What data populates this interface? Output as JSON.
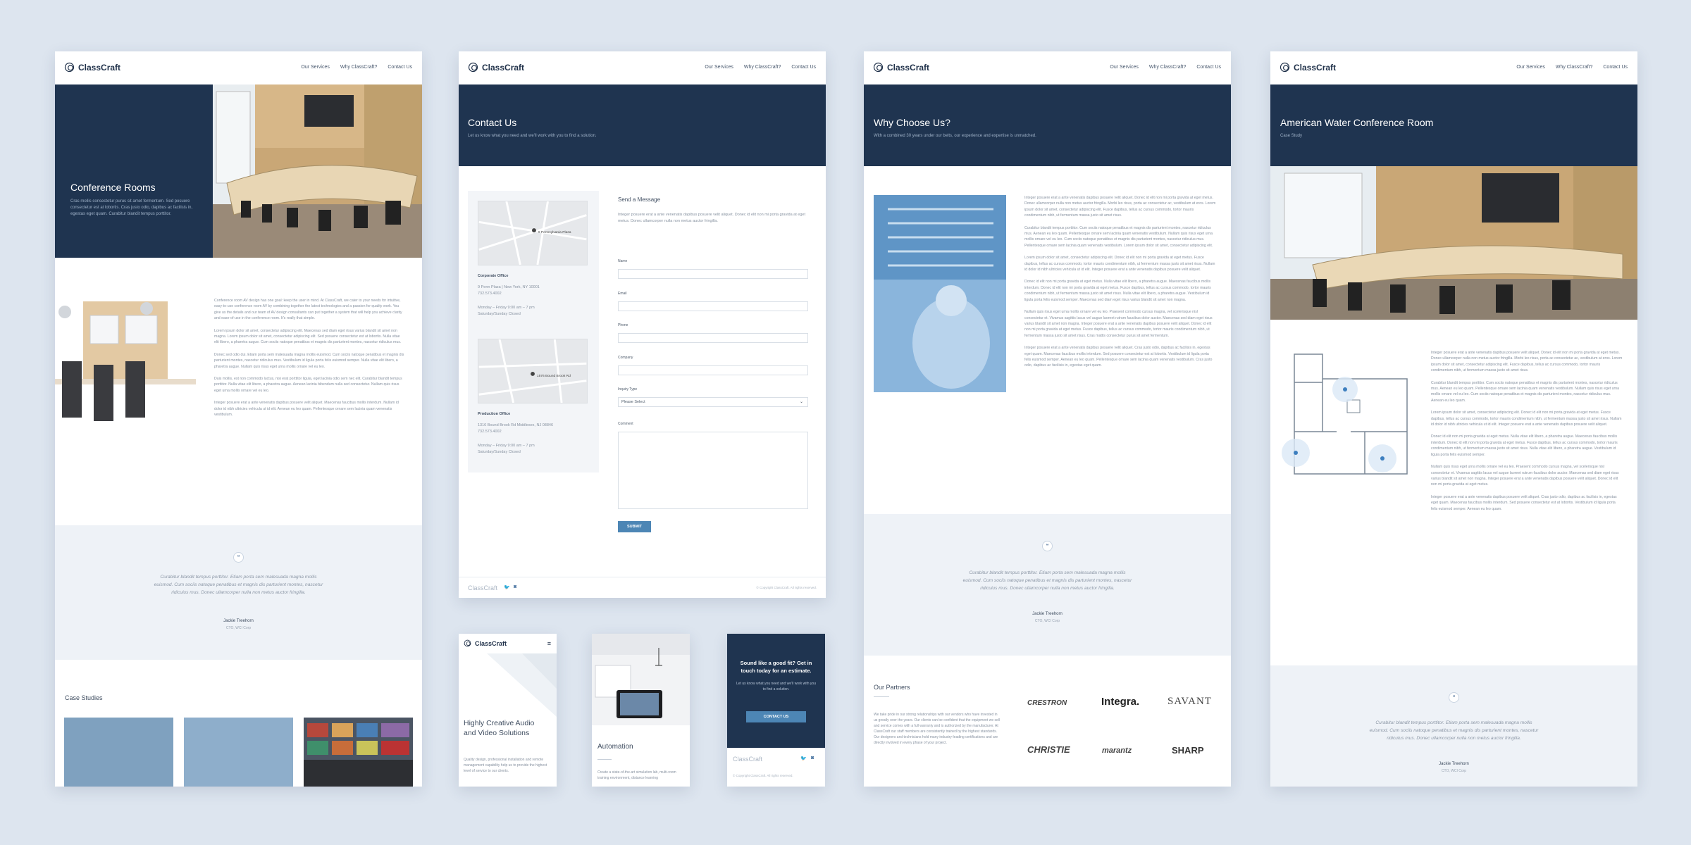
{
  "brand": {
    "name": "ClassCraft"
  },
  "nav": [
    "Our Services",
    "Why ClassCraft?",
    "Contact Us"
  ],
  "page1": {
    "hero_title": "Conference Rooms",
    "hero_sub": "Cras mollis consectetur purus sit amet fermentum. Sed posuere consectetur est at lobortis. Cras justo odio, dapibus ac facilisis in, egestas eget quam. Curabitur blandit tempus porttitor.",
    "paragraphs": [
      "Conference room AV design has one goal: keep the user in mind. At ClassCraft, we cater to your needs for intuitive, easy-to-use conference room AV by combining together the latest technologies and a passion for quality work. You give us the details and our team of AV design consultants can put together a system that will help you achieve clarity and ease-of-use in the conference room. It's really that simple.",
      "Lorem ipsum dolor sit amet, consectetur adipiscing elit. Maecenas sed diam eget risus varius blandit sit amet non magna. Lorem ipsum dolor sit amet, consectetur adipiscing elit. Sed posuere consectetur est at lobortis. Nulla vitae elit libero, a pharetra augue. Cum sociis natoque penatibus et magnis dis parturient montes, nascetur ridiculus mus.",
      "Donec sed odio dui. Etiam porta sem malesuada magna mollis euismod. Cum sociis natoque penatibus et magnis dis parturient montes, nascetur ridiculus mus. Vestibulum id ligula porta felis euismod semper. Nulla vitae elit libero, a pharetra augue. Nullam quis risus eget urna mollis ornare vel eu leo.",
      "Duis mollis, est non commodo luctus, nisi erat porttitor ligula, eget lacinia odio sem nec elit. Curabitur blandit tempus porttitor. Nulla vitae elit libero, a pharetra augue. Aenean lacinia bibendum nulla sed consectetur. Nullam quis risus eget urna mollis ornare vel eu leo.",
      "Integer posuere erat a ante venenatis dapibus posuere velit aliquet. Maecenas faucibus mollis interdum. Nullam id dolor id nibh ultricies vehicula ut id elit. Aenean eu leo quam. Pellentesque ornare sem lacinia quam venenatis vestibulum."
    ],
    "quote": "Curabitur blandit tempus porttitor. Etiam porta sem malesuada magna mollis euismod. Cum sociis natoque penatibus et magnis dis parturient montes, nascetur ridiculus mus. Donec ullamcorper nulla non metus auctor fringilla.",
    "quote_name": "Jackie Treehorn",
    "quote_role": "CTO, WCI Corp",
    "case_title": "Case Studies"
  },
  "page2": {
    "hero_title": "Contact Us",
    "hero_sub": "Let us know what you need and we'll work with you to find a solution.",
    "offices": [
      {
        "map_label": "9 Pennsylvania Plaza",
        "title": "Corporate Office",
        "address": "9 Penn Plaza | New York, NY 10001",
        "phone": "732.573.4002",
        "hours": "Monday – Friday 9:00 am – 7 pm",
        "weekend": "Saturday/Sunday Closed"
      },
      {
        "map_label": "1576 Bound Brook Rd",
        "title": "Production Office",
        "address": "1316 Bound Brook Rd Middlesex, NJ 08846",
        "phone": "732.573.4002",
        "hours": "Monday – Friday 9:00 am – 7 pm",
        "weekend": "Saturday/Sunday Closed"
      }
    ],
    "form_title": "Send a Message",
    "form_intro": "Integer posuere erat a ante venenatis dapibus posuere velit aliquet. Donec id elit non mi porta gravida at eget metus. Donec ullamcorper nulla non metus auctor fringilla.",
    "labels": {
      "name": "Name",
      "email": "Email",
      "phone": "Phone",
      "company": "Company",
      "inquiry": "Inquiry Type",
      "comment": "Comment"
    },
    "select_value": "Please Select",
    "submit": "SUBMIT",
    "copyright": "© Copyright ClassCraft. All rights reserved."
  },
  "page3": {
    "hero_title": "Why Choose Us?",
    "hero_sub": "With a combined 30 years under our belts, our experience and expertise is unmatched.",
    "paragraphs": [
      "Integer posuere erat a ante venenatis dapibus posuere velit aliquet. Donec id elit non mi porta gravida at eget metus. Donec ullamcorper nulla non metus auctor fringilla. Morbi leo risus, porta ac consectetur ac, vestibulum at eros. Lorem ipsum dolor sit amet, consectetur adipiscing elit. Fusce dapibus, tellus ac cursus commodo, tortor mauris condimentum nibh, ut fermentum massa justo sit amet risus.",
      "Curabitur blandit tempus porttitor. Cum sociis natoque penatibus et magnis dis parturient montes, nascetur ridiculus mus. Aenean eu leo quam. Pellentesque ornare sem lacinia quam venenatis vestibulum. Nullam quis risus eget urna mollis ornare vel eu leo. Cum sociis natoque penatibus et magnis dis parturient montes, nascetur ridiculus mus. Pellentesque ornare sem lacinia quam venenatis vestibulum. Lorem ipsum dolor sit amet, consectetur adipiscing elit.",
      "Lorem ipsum dolor sit amet, consectetur adipiscing elit. Donec id elit non mi porta gravida at eget metus. Fusce dapibus, tellus ac cursus commodo, tortor mauris condimentum nibh, ut fermentum massa justo sit amet risus. Nullam id dolor id nibh ultricies vehicula ut id elit. Integer posuere erat a ante venenatis dapibus posuere velit aliquet.",
      "Donec id elit non mi porta gravida at eget metus. Nulla vitae elit libero, a pharetra augue. Maecenas faucibus mollis interdum. Donec id elit non mi porta gravida at eget metus. Fusce dapibus, tellus ac cursus commodo, tortor mauris condimentum nibh, ut fermentum massa justo sit amet risus. Nulla vitae elit libero, a pharetra augue. Vestibulum id ligula porta felis euismod semper. Maecenas sed diam eget risus varius blandit sit amet non magna.",
      "Nullam quis risus eget urna mollis ornare vel eu leo. Praesent commodo cursus magna, vel scelerisque nisl consectetur et. Vivamus sagittis lacus vel augue laoreet rutrum faucibus dolor auctor. Maecenas sed diam eget risus varius blandit sit amet non magna. Integer posuere erat a ante venenatis dapibus posuere velit aliquet. Donec id elit non mi porta gravida at eget metus. Fusce dapibus, tellus ac cursus commodo, tortor mauris condimentum nibh, ut fermentum massa justo sit amet risus. Cras mattis consectetur purus sit amet fermentum.",
      "Integer posuere erat a ante venenatis dapibus posuere velit aliquet. Cras justo odio, dapibus ac facilisis in, egestas eget quam. Maecenas faucibus mollis interdum. Sed posuere consectetur est at lobortis. Vestibulum id ligula porta felis euismod semper. Aenean eu leo quam. Pellentesque ornare sem lacinia quam venenatis vestibulum. Cras justo odio, dapibus ac facilisis in, egestas eget quam."
    ],
    "quote": "Curabitur blandit tempus porttitor. Etiam porta sem malesuada magna mollis euismod. Cum sociis natoque penatibus et magnis dis parturient montes, nascetur ridiculus mus. Donec ullamcorper nulla non metus auctor fringilla.",
    "quote_name": "Jackie Treehorn",
    "quote_role": "CTO, WCI Corp",
    "partners_title": "Our Partners",
    "partners_text": "We take pride in our strong relationships with our vendors who have invested in us greatly over the years. Our clients can be confident that the equipment we sell and service comes with a full warranty and is authorized by the manufacturer. At ClassCraft our staff members are consistently trained by the highest standards. Our designers and technicians hold many industry-leading certifications and are directly involved in every phase of your project.",
    "partners": [
      "CRESTRON",
      "Integra.",
      "SAVANT",
      "CHRISTIE",
      "marantz",
      "SHARP"
    ]
  },
  "page4": {
    "hero_title": "American Water Conference Room",
    "hero_sub": "Case Study",
    "paragraphs": [
      "Integer posuere erat a ante venenatis dapibus posuere velit aliquet. Donec id elit non mi porta gravida at eget metus. Donec ullamcorper nulla non metus auctor fringilla. Morbi leo risus, porta ac consectetur ac, vestibulum at eros. Lorem ipsum dolor sit amet, consectetur adipiscing elit. Fusce dapibus, tellus ac cursus commodo, tortor mauris condimentum nibh, ut fermentum massa justo sit amet risus.",
      "Curabitur blandit tempus porttitor. Cum sociis natoque penatibus et magnis dis parturient montes, nascetur ridiculus mus. Aenean eu leo quam. Pellentesque ornare sem lacinia quam venenatis vestibulum. Nullam quis risus eget urna mollis ornare vel eu leo. Cum sociis natoque penatibus et magnis dis parturient montes, nascetur ridiculus mus. Aenean eu leo quam.",
      "Lorem ipsum dolor sit amet, consectetur adipiscing elit. Donec id elit non mi porta gravida at eget metus. Fusce dapibus, tellus ac cursus commodo, tortor mauris condimentum nibh, ut fermentum massa justo sit amet risus. Nullam id dolor id nibh ultricies vehicula ut id elit. Integer posuere erat a ante venenatis dapibus posuere velit aliquet.",
      "Donec id elit non mi porta gravida at eget metus. Nulla vitae elit libero, a pharetra augue. Maecenas faucibus mollis interdum. Donec id elit non mi porta gravida at eget metus. Fusce dapibus, tellus ac cursus commodo, tortor mauris condimentum nibh, ut fermentum massa justo sit amet risus. Nulla vitae elit libero, a pharetra augue. Vestibulum id ligula porta felis euismod semper.",
      "Nullam quis risus eget urna mollis ornare vel eu leo. Praesent commodo cursus magna, vel scelerisque nisl consectetur et. Vivamus sagittis lacus vel augue laoreet rutrum faucibus dolor auctor. Maecenas sed diam eget risus varius blandit sit amet non magna. Integer posuere erat a ante venenatis dapibus posuere velit aliquet. Donec id elit non mi porta gravida at eget metus.",
      "Integer posuere erat a ante venenatis dapibus posuere velit aliquet. Cras justo odio, dapibus ac facilisis in, egestas eget quam. Maecenas faucibus mollis interdum. Sed posuere consectetur est at lobortis. Vestibulum id ligula porta felis euismod semper. Aenean eu leo quam."
    ],
    "quote": "Curabitur blandit tempus porttitor. Etiam porta sem malesuada magna mollis euismod. Cum sociis natoque penatibus et magnis dis parturient montes, nascetur ridiculus mus. Donec ullamcorper nulla non metus auctor fringilla.",
    "quote_name": "Jackie Treehorn",
    "quote_role": "CTO, WCI Corp"
  },
  "mobile1": {
    "title": "Highly Creative Audio and Video Solutions",
    "text": "Quality design, professional installation and remote management capability help us to provide the highest level of service to our clients."
  },
  "mobile2": {
    "title": "Automation",
    "text": "Create a state-of-the-art simulation lab, multi-room training environment, distance learning"
  },
  "mobile3": {
    "cta": "Sound like a good fit? Get in touch today for an estimate.",
    "sub": "Let us know what you need and we'll work with you to find a solution.",
    "button": "CONTACT US",
    "copyright": "© Copyright ClassCraft. All rights reserved."
  }
}
